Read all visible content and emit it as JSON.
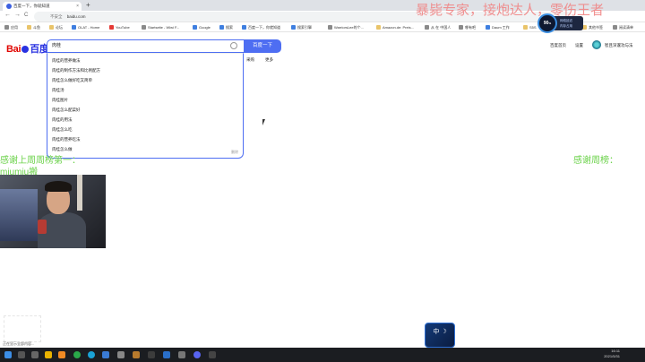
{
  "browser": {
    "tab_title": "百度一下，你就知道",
    "new_tab": "+",
    "address": "baidu.com",
    "insecure_label": "不安全",
    "nav": {
      "back": "←",
      "forward": "→",
      "reload": "C"
    }
  },
  "bookmarks": [
    "应用",
    "斗鱼",
    "论坛",
    "OLAT - Home",
    "YouTube",
    "Startseite - Wiwi F...",
    "Google",
    "搜索",
    "百度一下，你就知道",
    "搜索引擎",
    "WarriorsLee的个...",
    "Amazon.de: Preis...",
    "从 在 中国人",
    "哪有吧",
    "Daum 工作",
    "S5S",
    "其他书签",
    "阅读清单"
  ],
  "baidu": {
    "logo_bai": "Bai",
    "logo_du": "百度",
    "query": "肉桂",
    "search_button": "百度一下",
    "suggestions": [
      "肉桂的营养做法",
      "肉桂的制作方法和比例配方",
      "肉桂怎么做好吃又简单",
      "肉桂汤",
      "肉桂图片",
      "肉桂怎么配菜好",
      "肉桂的用法",
      "肉桂怎么吃",
      "肉桂的营养吃法",
      "肉桂怎么做"
    ],
    "delete_history": "删除",
    "nav_links": [
      "采购",
      "更多"
    ],
    "top_links": [
      "百度首页",
      "设置",
      "智且深邃功与法"
    ]
  },
  "overlay": {
    "title": "暴毙专家，接炮达人，零伤王者",
    "gauge_value": "90",
    "gauge_unit": "%",
    "gauge_lines": [
      "网络延迟",
      "内存占用"
    ],
    "thanks_left": "感谢上周周榜第一：",
    "thanks_name": "miumiu搬",
    "thanks_right": "感谢周榜：",
    "deco_text": "中 ☽"
  },
  "taskbar": {
    "notice": "正在显示全部内容...",
    "time": "16:11",
    "date": "2021/5/31"
  },
  "colors": {
    "accent": "#4e6ef2",
    "logo_red": "#e10602",
    "overlay_red": "#f08888",
    "overlay_green": "#6bd24a"
  }
}
